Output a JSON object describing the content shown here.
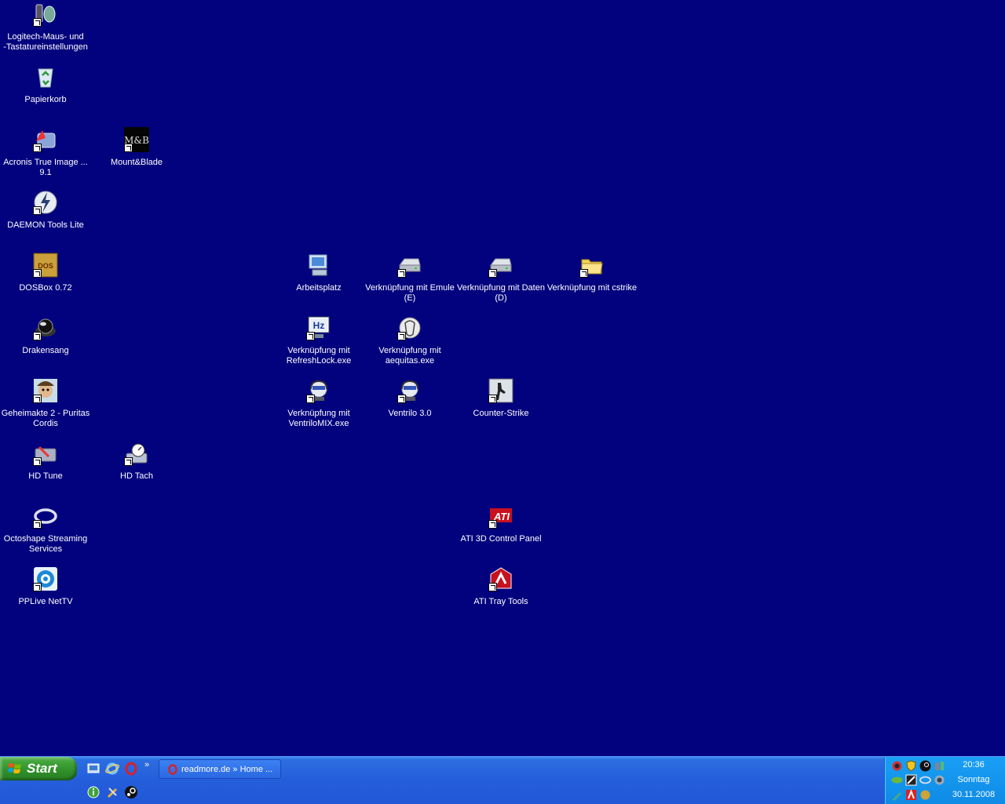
{
  "desktop": {
    "icons": [
      {
        "id": "logitech",
        "label": "Logitech-Maus- und\n-Tastatureinstellungen",
        "icon": "mouse-keyboard-icon",
        "shortcut": true
      },
      {
        "id": "recycle",
        "label": "Papierkorb",
        "icon": "recycle-bin-icon",
        "shortcut": false
      },
      {
        "id": "acronis",
        "label": "Acronis True Image ...\n9.1",
        "icon": "acronis-icon",
        "shortcut": true
      },
      {
        "id": "mountblade",
        "label": "Mount&Blade",
        "icon": "mount-blade-icon",
        "shortcut": true
      },
      {
        "id": "daemon",
        "label": "DAEMON Tools Lite",
        "icon": "daemon-tools-icon",
        "shortcut": true
      },
      {
        "id": "dosbox",
        "label": "DOSBox 0.72",
        "icon": "dosbox-icon",
        "shortcut": true
      },
      {
        "id": "drakensang",
        "label": "Drakensang",
        "icon": "drakensang-icon",
        "shortcut": true
      },
      {
        "id": "geheimakte",
        "label": "Geheimakte 2 - Puritas\nCordis",
        "icon": "geheimakte-icon",
        "shortcut": true
      },
      {
        "id": "hdtune",
        "label": "HD Tune",
        "icon": "hd-tune-icon",
        "shortcut": true
      },
      {
        "id": "hdtach",
        "label": "HD Tach",
        "icon": "hd-tach-icon",
        "shortcut": true
      },
      {
        "id": "octoshape",
        "label": "Octoshape Streaming\nServices",
        "icon": "octoshape-icon",
        "shortcut": true
      },
      {
        "id": "pplive",
        "label": "PPLive NetTV",
        "icon": "pplive-icon",
        "shortcut": true
      },
      {
        "id": "arbeitsplatz",
        "label": "Arbeitsplatz",
        "icon": "my-computer-icon",
        "shortcut": false
      },
      {
        "id": "emule",
        "label": "Verknüpfung mit Emule\n(E)",
        "icon": "drive-icon",
        "shortcut": true
      },
      {
        "id": "daten",
        "label": "Verknüpfung mit Daten\n(D)",
        "icon": "drive-icon",
        "shortcut": true
      },
      {
        "id": "cstrike",
        "label": "Verknüpfung mit cstrike",
        "icon": "folder-icon",
        "shortcut": true
      },
      {
        "id": "refreshlock",
        "label": "Verknüpfung mit\nRefreshLock.exe",
        "icon": "refreshlock-icon",
        "shortcut": true
      },
      {
        "id": "aequitas",
        "label": "Verknüpfung mit\naequitas.exe",
        "icon": "aequitas-icon",
        "shortcut": true
      },
      {
        "id": "ventrilomix",
        "label": "Verknüpfung mit\nVentriloMIX.exe",
        "icon": "ventrilo-icon",
        "shortcut": true
      },
      {
        "id": "ventrilo",
        "label": "Ventrilo 3.0",
        "icon": "ventrilo-icon",
        "shortcut": true
      },
      {
        "id": "counterstrike",
        "label": "Counter-Strike",
        "icon": "counter-strike-icon",
        "shortcut": true
      },
      {
        "id": "ati3d",
        "label": "ATI 3D Control Panel",
        "icon": "ati-icon",
        "shortcut": true
      },
      {
        "id": "atitray",
        "label": "ATI Tray Tools",
        "icon": "ati-tray-icon",
        "shortcut": true
      }
    ]
  },
  "taskbar": {
    "start_label": "Start",
    "quicklaunch": [
      "show-desktop-icon",
      "internet-explorer-icon",
      "opera-icon",
      "info-icon",
      "tools-icon",
      "steam-icon"
    ],
    "chevron": "»",
    "window_button": {
      "label": "readmore.de » Home ...",
      "icon": "opera-icon"
    },
    "clock": {
      "time": "20:36",
      "day": "Sonntag",
      "date": "30.11.2008"
    }
  },
  "colors": {
    "desktop": "#02027e",
    "taskbar": "#245edb",
    "tray": "#0f8be5",
    "start": "#2f8f29"
  }
}
